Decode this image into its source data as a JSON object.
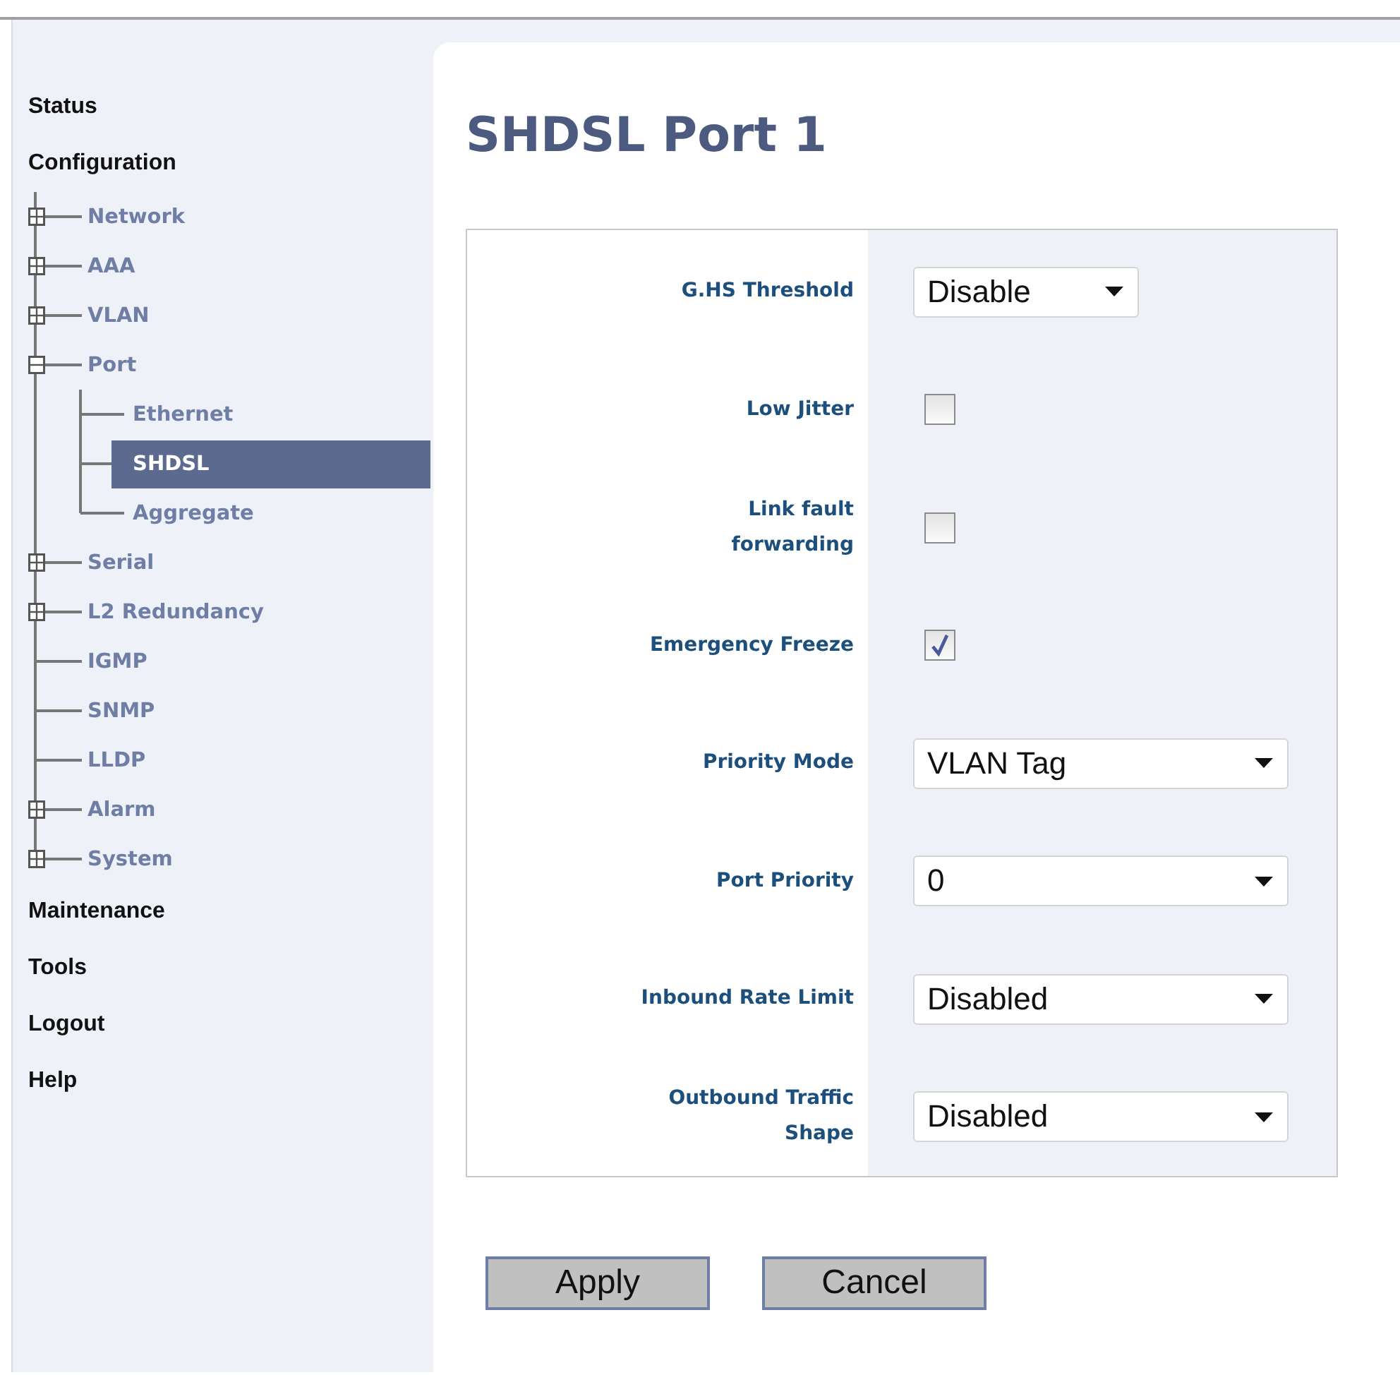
{
  "sidebar": {
    "items": [
      {
        "label": "Status"
      },
      {
        "label": "Configuration",
        "tree": [
          {
            "label": "Network",
            "kind": "folder",
            "expanded": false,
            "selected": false
          },
          {
            "label": "AAA",
            "kind": "folder",
            "expanded": false,
            "selected": false
          },
          {
            "label": "VLAN",
            "kind": "folder",
            "expanded": false,
            "selected": false
          },
          {
            "label": "Port",
            "kind": "folder",
            "expanded": true,
            "selected": false,
            "children": [
              {
                "label": "Ethernet",
                "selected": false
              },
              {
                "label": "SHDSL",
                "selected": true
              },
              {
                "label": "Aggregate",
                "selected": false
              }
            ]
          },
          {
            "label": "Serial",
            "kind": "folder",
            "expanded": false,
            "selected": false
          },
          {
            "label": "L2 Redundancy",
            "kind": "folder",
            "expanded": false,
            "selected": false
          },
          {
            "label": "IGMP",
            "kind": "leaf",
            "selected": false
          },
          {
            "label": "SNMP",
            "kind": "leaf",
            "selected": false
          },
          {
            "label": "LLDP",
            "kind": "leaf",
            "selected": false
          },
          {
            "label": "Alarm",
            "kind": "folder",
            "expanded": false,
            "selected": false
          },
          {
            "label": "System",
            "kind": "folder",
            "expanded": false,
            "selected": false
          }
        ]
      },
      {
        "label": "Maintenance"
      },
      {
        "label": "Tools"
      },
      {
        "label": "Logout"
      },
      {
        "label": "Help"
      }
    ]
  },
  "page": {
    "title": "SHDSL Port 1",
    "fields": [
      {
        "label": "G.HS Threshold",
        "kind": "select",
        "value": "Disable",
        "wide": false
      },
      {
        "label": "Low Jitter",
        "kind": "checkbox",
        "checked": false
      },
      {
        "label": "Link fault forwarding",
        "kind": "checkbox",
        "checked": false
      },
      {
        "label": "Emergency Freeze",
        "kind": "checkbox",
        "checked": true
      },
      {
        "label": "Priority Mode",
        "kind": "select",
        "value": "VLAN Tag",
        "wide": true
      },
      {
        "label": "Port Priority",
        "kind": "select",
        "value": "0",
        "wide": true
      },
      {
        "label": "Inbound Rate Limit",
        "kind": "select",
        "value": "Disabled",
        "wide": true
      },
      {
        "label": "Outbound Traffic Shape",
        "kind": "select",
        "value": "Disabled",
        "wide": true
      }
    ],
    "buttons": [
      "Apply",
      "Cancel"
    ]
  }
}
